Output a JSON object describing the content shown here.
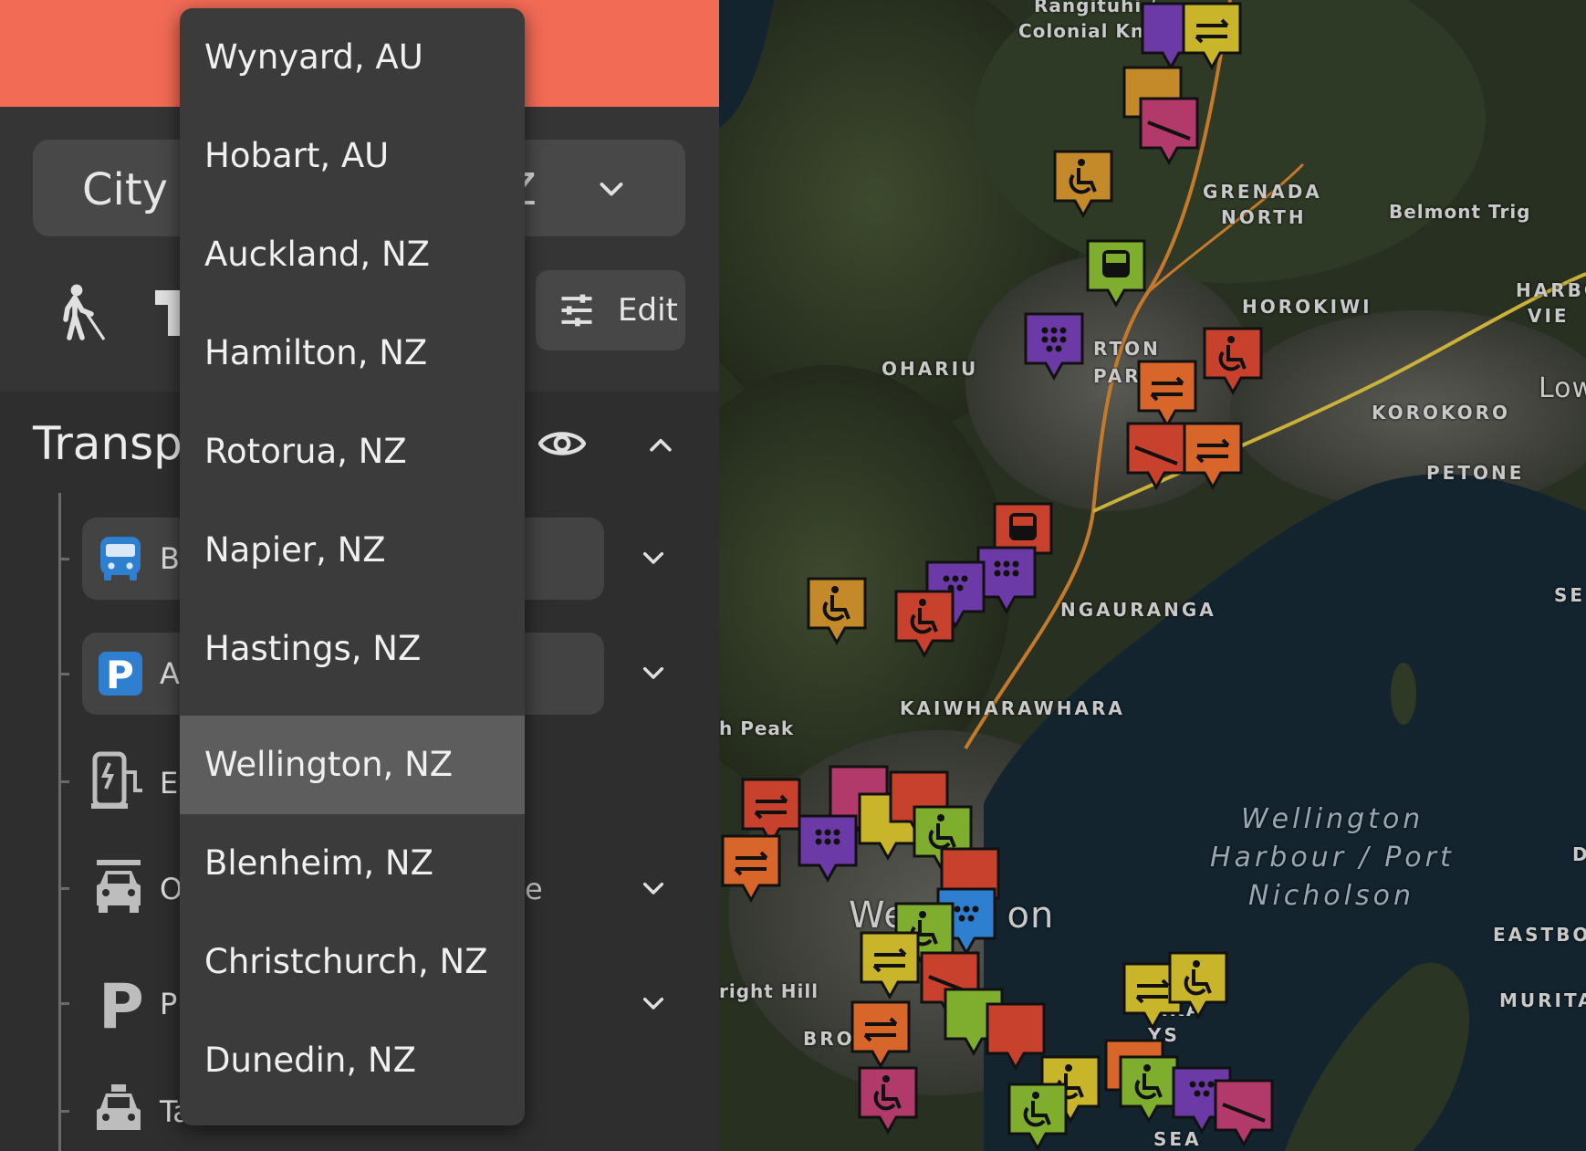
{
  "panel": {
    "city_select": {
      "label": "City",
      "value_tail": "Z"
    },
    "edit_button": {
      "label": "Edit"
    },
    "section": {
      "title": "Transp"
    },
    "rows": [
      {
        "label": "B",
        "suffix": ""
      },
      {
        "label": "A",
        "suffix": ""
      },
      {
        "label": "El",
        "suffix": ""
      },
      {
        "label": "O",
        "suffix": "e"
      },
      {
        "label": "P",
        "suffix": ""
      },
      {
        "label": "Ta",
        "suffix": ""
      }
    ]
  },
  "dropdown": {
    "selected": "Wellington, NZ",
    "options": [
      "Wynyard, AU",
      "Hobart, AU",
      "Auckland, NZ",
      "Hamilton, NZ",
      "Rotorua, NZ",
      "Napier, NZ",
      "Hastings, NZ",
      "Wellington, NZ",
      "Blenheim, NZ",
      "Christchurch, NZ",
      "Dunedin, NZ"
    ]
  },
  "map": {
    "labels": {
      "rangituhi": "Rangituhi /",
      "colonial": "Colonial Knol",
      "grenada1": "GRENADA",
      "grenada2": "NORTH",
      "belmont": "Belmont Trig",
      "horokiwi": "HOROKIWI",
      "harbour": "HARBO",
      "harbour2": "VIE",
      "ohariu": "OHARIU",
      "johnsonville1": "RTON",
      "johnsonville2": "PARK",
      "korokoro": "KOROKORO",
      "lower": "Low",
      "petone": "PETONE",
      "ngauranga": "NGAURANGA",
      "se": "SE",
      "kaiwhara": "KAIWHARAWHARA",
      "peak": "h Peak",
      "harbour_w1": "Wellington",
      "harbour_w2": "Harbour / Port",
      "harbour_w3": "Nicholson",
      "d": "D",
      "wellington": "We        on",
      "eastbo": "EASTBO",
      "bright": "right Hill",
      "murita": "MURITA",
      "bro": "BRO",
      "aka": "AKA",
      "ys": "YS",
      "sea": "SEA"
    },
    "colors": {
      "red": "#c8412c",
      "orange": "#d8662b",
      "yellow": "#c9b52a",
      "green": "#7fae2e",
      "purple": "#6b3aa6",
      "magenta": "#b23a6a",
      "blue": "#2f7fd0",
      "amber": "#c48a2a"
    }
  }
}
